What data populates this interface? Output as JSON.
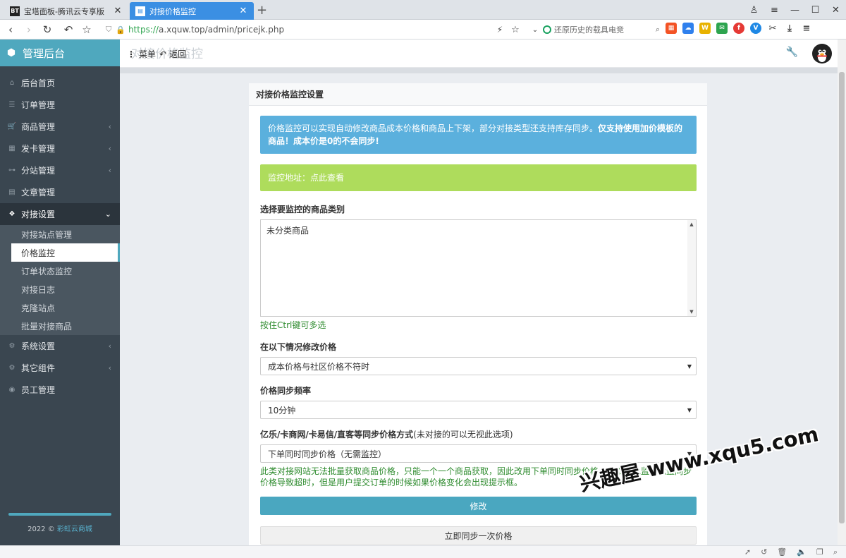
{
  "browser": {
    "tabs": [
      {
        "label": "宝塔面板-腾讯云专享版",
        "favicon": "BT"
      },
      {
        "label": "对接价格监控",
        "favicon": ""
      }
    ],
    "url_scheme": "https://",
    "url_rest": "a.xquw.top/admin/pricejk.php",
    "search_placeholder": "还原历史的载具电竞",
    "extensions": [
      {
        "icon": "windows-icon",
        "color": "#f35325"
      },
      {
        "icon": "cloud-icon",
        "color": "#2f80ed"
      },
      {
        "icon": "w-icon",
        "color": "#e8b200"
      },
      {
        "icon": "chat-icon",
        "color": "#2ea44f"
      },
      {
        "icon": "f-icon",
        "color": "#e53935"
      },
      {
        "icon": "v-icon",
        "color": "#1e88e5"
      }
    ]
  },
  "sidebar": {
    "brand": "管理后台",
    "items": [
      {
        "label": "后台首页",
        "icon": "home-icon",
        "glyph": "⌂",
        "arrow": false
      },
      {
        "label": "订单管理",
        "icon": "list-icon",
        "glyph": "☰",
        "arrow": false
      },
      {
        "label": "商品管理",
        "icon": "cart-icon",
        "glyph": "🛒",
        "arrow": true
      },
      {
        "label": "发卡管理",
        "icon": "grid-icon",
        "glyph": "▦",
        "arrow": true
      },
      {
        "label": "分站管理",
        "icon": "sitemap-icon",
        "glyph": "⊶",
        "arrow": true
      },
      {
        "label": "文章管理",
        "icon": "book-icon",
        "glyph": "▤",
        "arrow": false
      },
      {
        "label": "对接设置",
        "icon": "cubes-icon",
        "glyph": "❖",
        "arrow": true,
        "active": true
      }
    ],
    "subitems": [
      {
        "label": "对接站点管理"
      },
      {
        "label": "价格监控",
        "active": true
      },
      {
        "label": "订单状态监控"
      },
      {
        "label": "对接日志"
      },
      {
        "label": "克隆站点"
      },
      {
        "label": "批量对接商品"
      }
    ],
    "items2": [
      {
        "label": "系统设置",
        "icon": "gear-icon",
        "glyph": "⚙",
        "arrow": true
      },
      {
        "label": "其它组件",
        "icon": "gears-icon",
        "glyph": "⚙",
        "arrow": true
      },
      {
        "label": "员工管理",
        "icon": "user-icon",
        "glyph": "◉",
        "arrow": false
      }
    ],
    "footer_year": "2022 © ",
    "footer_link": "彩虹云商城"
  },
  "header": {
    "menu_label": "菜单",
    "back_label": "返回",
    "ghost_title": "对接价格监控"
  },
  "panel": {
    "title": "对接价格监控设置",
    "info_plain": "价格监控可以实现自动修改商品成本价格和商品上下架，部分对接类型还支持库存同步。",
    "info_bold": "仅支持使用加价模板的商品！成本价是0的不会同步!",
    "success_text": "监控地址：点此查看",
    "category_label": "选择要监控的商品类别",
    "category_option": "未分类商品",
    "category_help": "按住Ctrl键可多选",
    "condition_label": "在以下情况修改价格",
    "condition_value": "成本价格与社区价格不符时",
    "freq_label": "价格同步频率",
    "freq_value": "10分钟",
    "sync_label_bold": "亿乐/卡商网/卡易信/直客等同步价格方式",
    "sync_label_note": "(未对接的可以无视此选项)",
    "sync_value": "下单同时同步价格（无需监控）",
    "sync_help": "此类对接网站无法批量获取商品价格，只能一个一个商品获取，因此改用下单同时同步价格，可以避免监控批量同步价格导致超时，但是用户提交订单的时候如果价格变化会出现提示框。",
    "submit_label": "修改",
    "sync_now_label": "立即同步一次价格"
  },
  "watermark": "兴趣屋 www.xqu5.com"
}
